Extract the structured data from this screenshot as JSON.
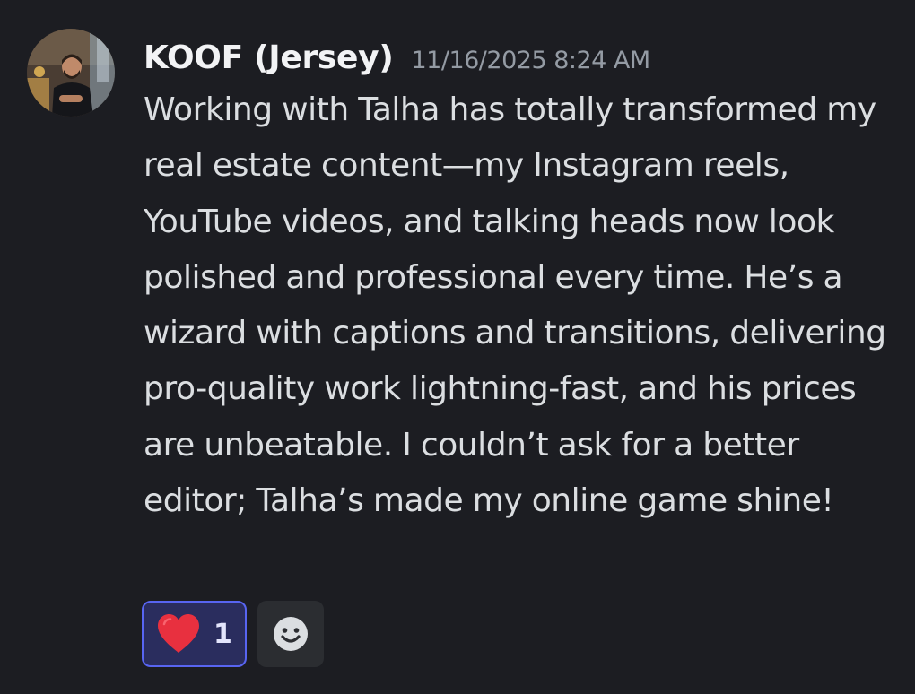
{
  "message": {
    "author": "KOOF (Jersey)",
    "timestamp": "11/16/2025 8:24 AM",
    "text": "Working with Talha has totally transformed my real estate content—my Instagram reels, YouTube videos, and talking heads now look polished and professional every time. He’s a wizard with captions and transitions, delivering pro-quality work lightning-fast, and his prices are unbeatable. I couldn’t ask for a better editor; Talha’s made my online game shine!"
  },
  "reactions": [
    {
      "emoji": "heart-icon",
      "count": "1",
      "selected": true
    }
  ],
  "colors": {
    "background": "#1c1d22",
    "accent": "#5865f2",
    "heart": "#e8303f",
    "timestamp": "#949ba4"
  }
}
